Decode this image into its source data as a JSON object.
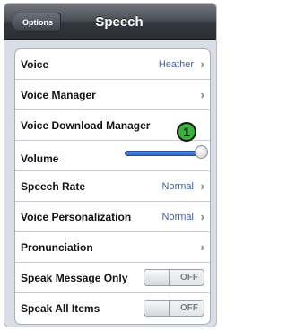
{
  "navbar": {
    "back_label": "Options",
    "title": "Speech"
  },
  "rows": [
    {
      "label": "Voice",
      "value": "Heather",
      "chevron": "›"
    },
    {
      "label": "Voice Manager",
      "chevron": "›"
    },
    {
      "label": "Voice Download Manager"
    },
    {
      "label": "Volume",
      "volume_level": 0.95
    },
    {
      "label": "Speech Rate",
      "value": "Normal",
      "chevron": "›"
    },
    {
      "label": "Voice Personalization",
      "value": "Normal",
      "chevron": "›"
    },
    {
      "label": "Pronunciation",
      "chevron": "›"
    },
    {
      "label": "Speak Message Only",
      "toggle": "OFF"
    },
    {
      "label": "Speak All Items",
      "toggle": "OFF"
    }
  ],
  "callout": {
    "number": "1",
    "color": "#36b33a"
  },
  "colors": {
    "accent_value": "#3d62a6",
    "navbar": "#3a3f45"
  }
}
